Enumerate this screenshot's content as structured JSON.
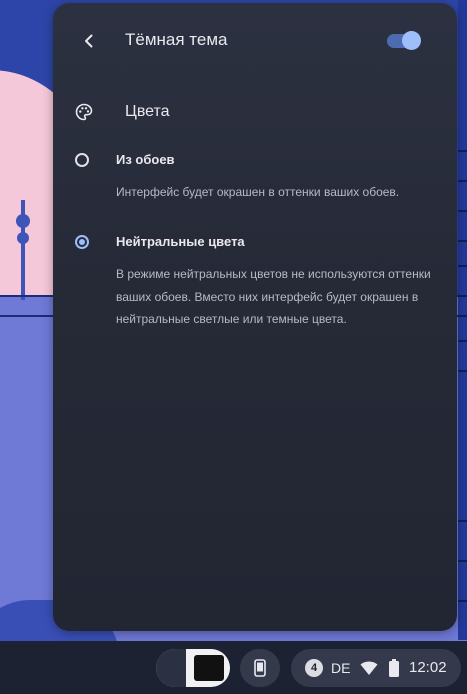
{
  "panel": {
    "title": "Тёмная тема",
    "back_icon": "chevron-left-icon",
    "dark_theme_toggle": {
      "on": true
    },
    "section": {
      "icon": "palette-icon",
      "label": "Цвета"
    },
    "options": [
      {
        "label": "Из обоев",
        "description": "Интерфейс будет окрашен в оттенки ваших обоев.",
        "selected": false
      },
      {
        "label": "Нейтральные цвета",
        "description": "В режиме нейтральных цветов не используются оттенки ваших обоев. Вместо них интерфейс будет окрашен в нейтральные светлые или темные цвета.",
        "selected": true
      }
    ]
  },
  "shelf": {
    "phone_icon": "phone-icon",
    "status": {
      "notification_count": "4",
      "keyboard_layout": "DE",
      "wifi_icon": "wifi-icon",
      "battery_icon": "battery-icon",
      "time": "12:02"
    }
  },
  "colors": {
    "accent": "#9dbdfb",
    "panel_bg": "#282c3a",
    "shelf_bg": "#1d2233"
  }
}
